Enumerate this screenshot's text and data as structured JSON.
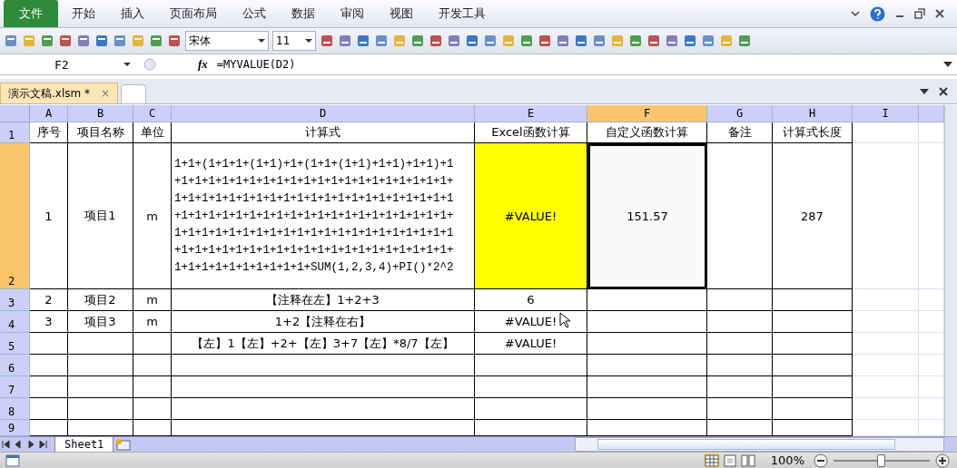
{
  "menu": [
    {
      "label": "文件",
      "selected": true
    },
    {
      "label": "开始",
      "selected": false
    },
    {
      "label": "插入",
      "selected": false
    },
    {
      "label": "页面布局",
      "selected": false
    },
    {
      "label": "公式",
      "selected": false
    },
    {
      "label": "数据",
      "selected": false
    },
    {
      "label": "审阅",
      "selected": false
    },
    {
      "label": "视图",
      "selected": false
    },
    {
      "label": "开发工具",
      "selected": false
    }
  ],
  "toolbar": {
    "font": "宋体",
    "size": "11"
  },
  "formula_bar": {
    "name_box": "F2",
    "fx": "fx",
    "formula": "=MYVALUE(D2)"
  },
  "doc_tabs": [
    {
      "label": "演示文稿.xlsm *",
      "selected": true,
      "close": "×"
    }
  ],
  "columns": [
    {
      "label": "A",
      "selected": false
    },
    {
      "label": "B",
      "selected": false
    },
    {
      "label": "C",
      "selected": false
    },
    {
      "label": "D",
      "selected": false
    },
    {
      "label": "E",
      "selected": false
    },
    {
      "label": "F",
      "selected": true
    },
    {
      "label": "G",
      "selected": false
    },
    {
      "label": "H",
      "selected": false
    },
    {
      "label": "I",
      "selected": false
    }
  ],
  "rows": [
    {
      "header": "1",
      "selected": false,
      "cells": [
        {
          "text": "序号",
          "highlighted": false,
          "selected": false
        },
        {
          "text": "项目名称",
          "highlighted": false,
          "selected": false
        },
        {
          "text": "单位",
          "highlighted": false,
          "selected": false
        },
        {
          "text": "计算式",
          "highlighted": false,
          "selected": false
        },
        {
          "text": "Excel函数计算",
          "highlighted": false,
          "selected": false
        },
        {
          "text": "自定义函数计算",
          "highlighted": false,
          "selected": false
        },
        {
          "text": "备注",
          "highlighted": false,
          "selected": false
        },
        {
          "text": "计算式长度",
          "highlighted": false,
          "selected": false
        },
        {
          "highlighted": false,
          "selected": false
        }
      ]
    },
    {
      "header": "2",
      "selected": true,
      "cells": [
        {
          "text": "1",
          "highlighted": false,
          "selected": false
        },
        {
          "text": "项目1",
          "highlighted": false,
          "selected": false
        },
        {
          "text": "m",
          "highlighted": false,
          "selected": false
        },
        {
          "text": "1+1+(1+1+1+(1+1)+1+(1+1+(1+1)+1+1)+1+1)+1+1+1+1+1+1+1+1+1+1+1+1+1+1+1+1+1+1+1+1+1+1+1+1+1+1+1+1+1+1+1+1+1+1+1+1+1+1+1+1+1+1+1+1+1+1+1+1+1+1+1+1+1+1+1+1+1+1+1+1+1+1+1+1+1+1+1+1+1+1+1+1+1+1+1+1+1+1+1+1+1+1+1+1+1+1+1+1+1+1+1+1+1+1+1+1+1+1+1+1+1+1+1+1+1+1+1+1+1+1+1+1+1+SUM(1,2,3,4)+PI()*2^2",
          "highlighted": false,
          "selected": false
        },
        {
          "text": "#VALUE!",
          "highlighted": true,
          "selected": false
        },
        {
          "text": "151.57",
          "highlighted": false,
          "selected": true
        },
        {
          "highlighted": false,
          "selected": false
        },
        {
          "text": "287",
          "highlighted": false,
          "selected": false
        },
        {
          "highlighted": false,
          "selected": false
        }
      ]
    },
    {
      "header": "3",
      "selected": false,
      "cells": [
        {
          "text": "2",
          "highlighted": false,
          "selected": false
        },
        {
          "text": "项目2",
          "highlighted": false,
          "selected": false
        },
        {
          "text": "m",
          "highlighted": false,
          "selected": false
        },
        {
          "text": "【注释在左】1+2+3",
          "highlighted": false,
          "selected": false
        },
        {
          "text": "6",
          "highlighted": false,
          "selected": false
        },
        {
          "highlighted": false,
          "selected": false
        },
        {
          "highlighted": false,
          "selected": false
        },
        {
          "highlighted": false,
          "selected": false
        },
        {
          "highlighted": false,
          "selected": false
        }
      ]
    },
    {
      "header": "4",
      "selected": false,
      "cells": [
        {
          "text": "3",
          "highlighted": false,
          "selected": false
        },
        {
          "text": "项目3",
          "highlighted": false,
          "selected": false
        },
        {
          "text": "m",
          "highlighted": false,
          "selected": false
        },
        {
          "text": "1+2【注释在右】",
          "highlighted": false,
          "selected": false
        },
        {
          "text": "#VALUE!",
          "highlighted": false,
          "selected": false
        },
        {
          "highlighted": false,
          "selected": false
        },
        {
          "highlighted": false,
          "selected": false
        },
        {
          "highlighted": false,
          "selected": false
        },
        {
          "highlighted": false,
          "selected": false
        }
      ]
    },
    {
      "header": "5",
      "selected": false,
      "cells": [
        {
          "highlighted": false,
          "selected": false
        },
        {
          "highlighted": false,
          "selected": false
        },
        {
          "highlighted": false,
          "selected": false
        },
        {
          "text": "【左】1【左】+2+【左】3+7【左】*8/7【左】",
          "highlighted": false,
          "selected": false
        },
        {
          "text": "#VALUE!",
          "highlighted": false,
          "selected": false
        },
        {
          "highlighted": false,
          "selected": false
        },
        {
          "highlighted": false,
          "selected": false
        },
        {
          "highlighted": false,
          "selected": false
        },
        {
          "highlighted": false,
          "selected": false
        }
      ]
    },
    {
      "header": "6",
      "selected": false
    },
    {
      "header": "7",
      "selected": false
    },
    {
      "header": "8",
      "selected": false
    },
    {
      "header": "9",
      "selected": false
    }
  ],
  "sheet_tabs": [
    {
      "label": "Sheet1",
      "selected": true
    }
  ],
  "status_bar": {
    "zoom": "100%",
    "zoom_slider": {
      "level": 0.5
    }
  }
}
